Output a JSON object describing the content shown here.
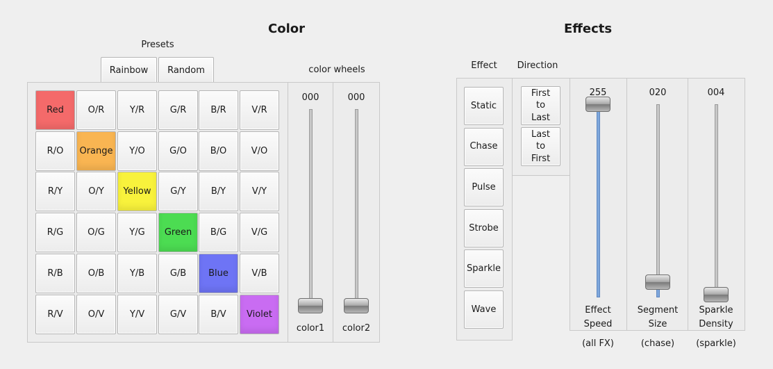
{
  "color": {
    "title": "Color",
    "presets": {
      "label": "Presets",
      "buttons": [
        "Rainbow",
        "Random"
      ]
    },
    "grid": [
      [
        {
          "label": "Red",
          "color": "#f46a6a"
        },
        {
          "label": "O/R"
        },
        {
          "label": "Y/R"
        },
        {
          "label": "G/R"
        },
        {
          "label": "B/R"
        },
        {
          "label": "V/R"
        }
      ],
      [
        {
          "label": "R/O"
        },
        {
          "label": "Orange",
          "color": "#f9b552"
        },
        {
          "label": "Y/O"
        },
        {
          "label": "G/O"
        },
        {
          "label": "B/O"
        },
        {
          "label": "V/O"
        }
      ],
      [
        {
          "label": "R/Y"
        },
        {
          "label": "O/Y"
        },
        {
          "label": "Yellow",
          "color": "#f8f23c"
        },
        {
          "label": "G/Y"
        },
        {
          "label": "B/Y"
        },
        {
          "label": "V/Y"
        }
      ],
      [
        {
          "label": "R/G"
        },
        {
          "label": "O/G"
        },
        {
          "label": "Y/G"
        },
        {
          "label": "Green",
          "color": "#4cdc52"
        },
        {
          "label": "B/G"
        },
        {
          "label": "V/G"
        }
      ],
      [
        {
          "label": "R/B"
        },
        {
          "label": "O/B"
        },
        {
          "label": "Y/B"
        },
        {
          "label": "G/B"
        },
        {
          "label": "Blue",
          "color": "#6e74f5"
        },
        {
          "label": "V/B"
        }
      ],
      [
        {
          "label": "R/V"
        },
        {
          "label": "O/V"
        },
        {
          "label": "Y/V"
        },
        {
          "label": "G/V"
        },
        {
          "label": "B/V"
        },
        {
          "label": "Violet",
          "color": "#c96cf2"
        }
      ]
    ],
    "wheels": {
      "label": "color wheels",
      "sliders": [
        {
          "value": "000",
          "label": "color1",
          "level": 0
        },
        {
          "value": "000",
          "label": "color2",
          "level": 0
        }
      ]
    }
  },
  "effects": {
    "title": "Effects",
    "effect_label": "Effect",
    "direction_label": "Direction",
    "effect_buttons": [
      "Static",
      "Chase",
      "Pulse",
      "Strobe",
      "Sparkle",
      "Wave"
    ],
    "direction_buttons": [
      "First to Last",
      "Last to First"
    ],
    "sliders": [
      {
        "value": "255",
        "label_line1": "Effect",
        "label_line2": "Speed",
        "sub": "(all FX)",
        "level": 1.0,
        "fill_color": "#7ea7dc"
      },
      {
        "value": "020",
        "label_line1": "Segment",
        "label_line2": "Size",
        "sub": "(chase)",
        "level": 0.078
      },
      {
        "value": "004",
        "label_line1": "Sparkle",
        "label_line2": "Density",
        "sub": "(sparkle)",
        "level": 0.016
      }
    ]
  }
}
